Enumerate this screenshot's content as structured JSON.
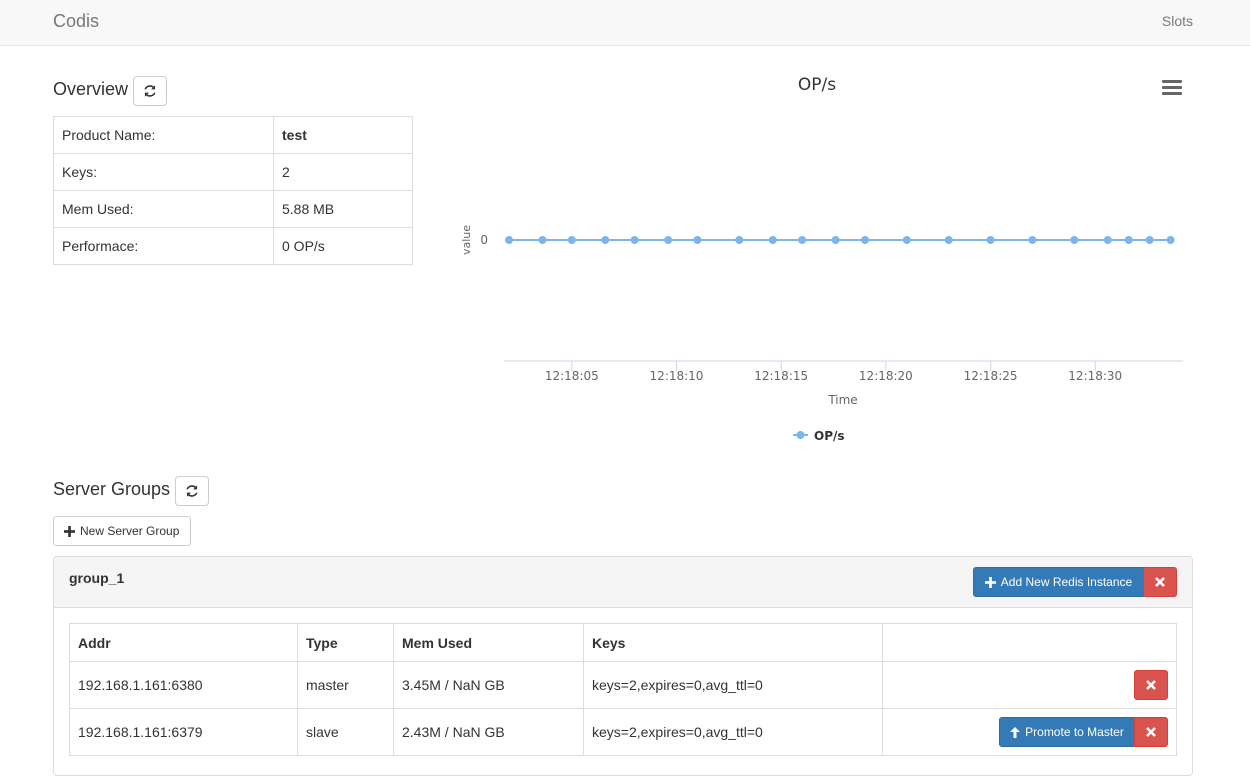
{
  "nav": {
    "brand": "Codis",
    "slots_link": "Slots"
  },
  "overview": {
    "title": "Overview",
    "rows": [
      {
        "label": "Product Name:",
        "value": "test"
      },
      {
        "label": "Keys:",
        "value": "2"
      },
      {
        "label": "Mem Used:",
        "value": "5.88 MB"
      },
      {
        "label": "Performace:",
        "value": "0 OP/s"
      }
    ]
  },
  "chart_data": {
    "type": "line",
    "title": "OP/s",
    "xlabel": "Time",
    "ylabel": "value",
    "x_ticks": [
      "12:18:05",
      "12:18:10",
      "12:18:15",
      "12:18:20",
      "12:18:25",
      "12:18:30"
    ],
    "y_ticks": [
      "0"
    ],
    "series": [
      {
        "name": "OP/s",
        "x": [
          "12:18:02",
          "12:18:03.6",
          "12:18:05",
          "12:18:06.6",
          "12:18:08",
          "12:18:09.6",
          "12:18:11",
          "12:18:13",
          "12:18:14.6",
          "12:18:16",
          "12:18:17.6",
          "12:18:19",
          "12:18:21",
          "12:18:23",
          "12:18:25",
          "12:18:27",
          "12:18:29",
          "12:18:30.6",
          "12:18:31.6",
          "12:18:32.6",
          "12:18:33.6"
        ],
        "values": [
          0,
          0,
          0,
          0,
          0,
          0,
          0,
          0,
          0,
          0,
          0,
          0,
          0,
          0,
          0,
          0,
          0,
          0,
          0,
          0,
          0
        ]
      }
    ],
    "xlim": [
      "12:18:02",
      "12:18:34"
    ],
    "grid": false,
    "legend": "bottom-center",
    "color": "#7cb5ec"
  },
  "server_groups": {
    "title": "Server Groups",
    "new_button": "New Server Group",
    "groups": [
      {
        "name": "group_1",
        "add_button": "Add New Redis Instance",
        "columns": [
          "Addr",
          "Type",
          "Mem Used",
          "Keys",
          ""
        ],
        "servers": [
          {
            "addr": "192.168.1.161:6380",
            "type": "master",
            "mem": "3.45M / NaN GB",
            "keys": "keys=2,expires=0,avg_ttl=0"
          },
          {
            "addr": "192.168.1.161:6379",
            "type": "slave",
            "mem": "2.43M / NaN GB",
            "keys": "keys=2,expires=0,avg_ttl=0",
            "promote_label": "Promote to Master"
          }
        ]
      }
    ]
  },
  "icons": {
    "refresh": "refresh-icon",
    "plus": "plus-icon",
    "remove": "remove-icon",
    "arrow_up": "arrow-up-icon",
    "menu": "hamburger-menu-icon"
  },
  "colors": {
    "primary": "#337ab7",
    "danger": "#d9534f",
    "chart_line": "#7cb5ec"
  }
}
